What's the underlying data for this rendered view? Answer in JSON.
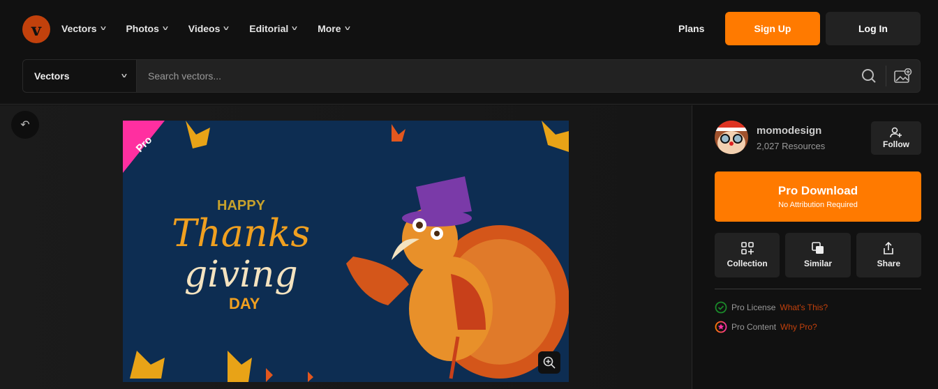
{
  "header": {
    "logo": "v",
    "nav": [
      {
        "label": "Vectors"
      },
      {
        "label": "Photos"
      },
      {
        "label": "Videos"
      },
      {
        "label": "Editorial"
      },
      {
        "label": "More"
      }
    ],
    "plans": "Plans",
    "signup": "Sign Up",
    "login": "Log In"
  },
  "search": {
    "category": "Vectors",
    "placeholder": "Search vectors..."
  },
  "image": {
    "badge": "Pro",
    "art_text": {
      "happy": "HAPPY",
      "thanks": "Thanks",
      "giving": "giving",
      "day": "DAY"
    }
  },
  "author": {
    "name": "momodesign",
    "resources": "2,027 Resources",
    "follow": "Follow"
  },
  "download": {
    "title": "Pro Download",
    "subtitle": "No Attribution Required"
  },
  "actions": [
    {
      "label": "Collection"
    },
    {
      "label": "Similar"
    },
    {
      "label": "Share"
    }
  ],
  "license": {
    "label": "Pro License",
    "link": "What's This?"
  },
  "content": {
    "label": "Pro Content",
    "link": "Why Pro?"
  },
  "colors": {
    "accent": "#ff7a00",
    "link": "#c2410c"
  }
}
